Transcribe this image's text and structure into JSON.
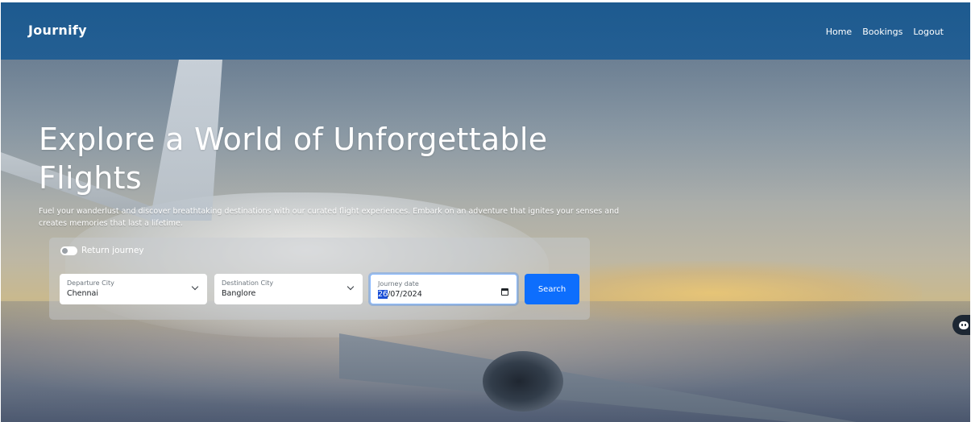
{
  "navbar": {
    "brand": "Journify",
    "links": [
      "Home",
      "Bookings",
      "Logout"
    ]
  },
  "hero": {
    "title": "Explore a World of Unforgettable Flights",
    "subtitle": "Fuel your wanderlust and discover breathtaking destinations with our curated flight experiences. Embark on an adventure that ignites your senses and creates memories that last a lifetime."
  },
  "search": {
    "return_journey_label": "Return journey",
    "return_journey_enabled": false,
    "departure": {
      "label": "Departure City",
      "value": "Chennai"
    },
    "destination": {
      "label": "Destination City",
      "value": "Banglore"
    },
    "date": {
      "label": "Journey date",
      "day": "26",
      "rest": "/07/2024"
    },
    "button_label": "Search"
  },
  "colors": {
    "navbar": "#1d5a8f",
    "primary_button": "#0d6efd",
    "chat_bubble": "#1d2733"
  },
  "icons": [
    "chevron-down-icon",
    "calendar-icon",
    "chat-bot-icon"
  ]
}
